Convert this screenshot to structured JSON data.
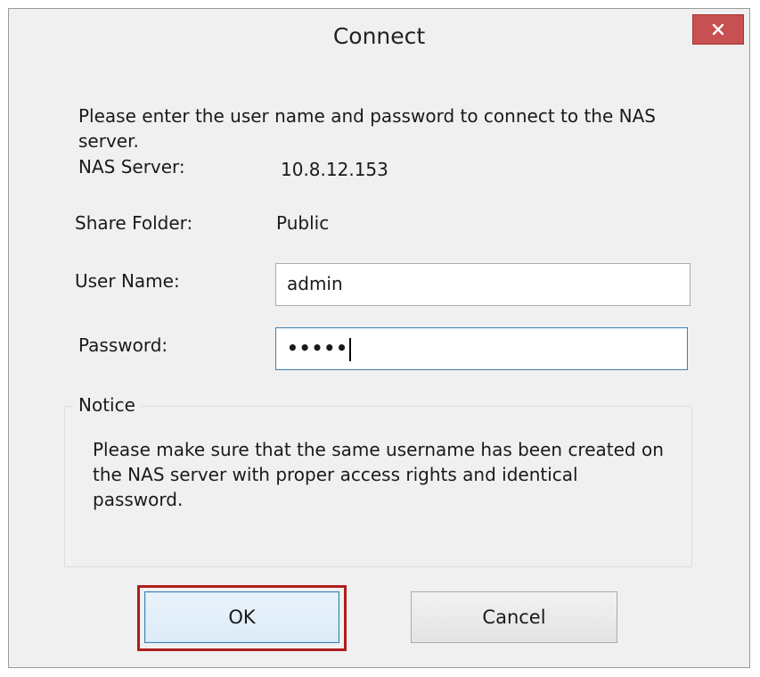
{
  "window": {
    "title": "Connect"
  },
  "intro_text": "Please enter the user name and password to connect to the NAS server.",
  "fields": {
    "nas_server": {
      "label": "NAS Server:",
      "value": "10.8.12.153"
    },
    "share_folder": {
      "label": "Share Folder:",
      "value": "Public"
    },
    "user_name": {
      "label": "User Name:",
      "value": "admin"
    },
    "password": {
      "label": "Password:",
      "value": "•••••"
    }
  },
  "notice": {
    "title": "Notice",
    "text": "Please make sure that the same username has been created on the NAS server with proper access rights and identical password."
  },
  "buttons": {
    "ok": "OK",
    "cancel": "Cancel"
  },
  "icons": {
    "close": "close-icon"
  },
  "colors": {
    "close_button": "#c75050",
    "highlight_border": "#b01e1e",
    "focus_border": "#3c7fb1"
  }
}
